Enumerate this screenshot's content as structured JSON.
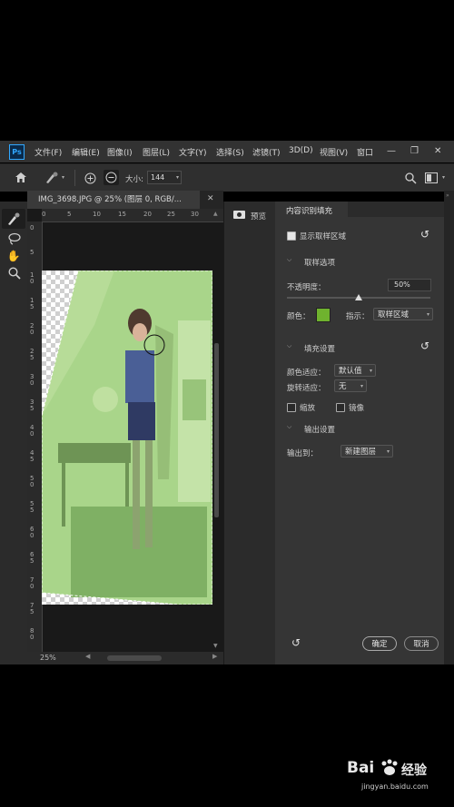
{
  "menubar": {
    "app_icon": "Ps",
    "items": [
      "文件(F)",
      "编辑(E)",
      "图像(I)",
      "图层(L)",
      "文字(Y)",
      "选择(S)",
      "滤镜(T)",
      "3D(D)",
      "视图(V)",
      "窗口"
    ]
  },
  "options": {
    "size_label": "大小:",
    "size_value": "144"
  },
  "document": {
    "tab_title": "IMG_3698.JPG @ 25% (图层 0, RGB/...",
    "zoom": "25%",
    "ruler_top": [
      "0",
      "5",
      "10",
      "15",
      "20",
      "25",
      "30"
    ],
    "ruler_left": [
      "0",
      "5",
      "1\n0",
      "1\n5",
      "2\n0",
      "2\n5",
      "3\n0",
      "3\n5",
      "4\n0",
      "4\n5",
      "5\n0",
      "5\n5",
      "6\n0",
      "6\n5",
      "7\n0",
      "7\n5",
      "8\n0"
    ]
  },
  "midpanel": {
    "preview_label": "预览"
  },
  "panel": {
    "title": "内容识别填充",
    "show_sampling_label": "显示取样区域",
    "sampling_options_heading": "取样选项",
    "opacity_label": "不透明度：",
    "opacity_value": "50%",
    "opacity_fraction": 0.5,
    "color_label": "颜色：",
    "overlay_color": "#6fb22e",
    "indicate_label": "指示：",
    "indicate_value": "取样区域",
    "fill_settings_heading": "填充设置",
    "color_adapt_label": "颜色适应：",
    "color_adapt_value": "默认值",
    "rotation_adapt_label": "旋转适应：",
    "rotation_adapt_value": "无",
    "scale_label": "缩放",
    "mirror_label": "镜像",
    "output_settings_heading": "输出设置",
    "output_to_label": "输出到：",
    "output_to_value": "新建图层",
    "ok_label": "确定",
    "cancel_label": "取消"
  },
  "watermark": {
    "brand": "Bai",
    "brand_cn": "经验",
    "url": "jingyan.baidu.com"
  }
}
